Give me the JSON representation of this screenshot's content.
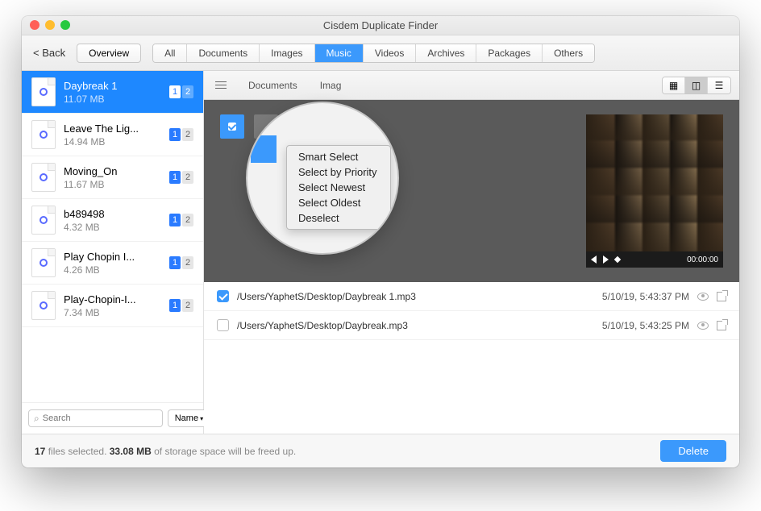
{
  "window": {
    "title": "Cisdem Duplicate Finder"
  },
  "toolbar": {
    "back": "< Back",
    "overview": "Overview",
    "tabs": [
      "All",
      "Documents",
      "Images",
      "Music",
      "Videos",
      "Archives",
      "Packages",
      "Others"
    ],
    "active_tab_index": 3
  },
  "sidebar": {
    "items": [
      {
        "name": "Daybreak 1",
        "size": "11.07 MB",
        "b1": "1",
        "b2": "2",
        "selected": true
      },
      {
        "name": "Leave The Lig...",
        "size": "14.94 MB",
        "b1": "1",
        "b2": "2",
        "selected": false
      },
      {
        "name": "Moving_On",
        "size": "11.67 MB",
        "b1": "1",
        "b2": "2",
        "selected": false
      },
      {
        "name": "b489498",
        "size": "4.32 MB",
        "b1": "1",
        "b2": "2",
        "selected": false
      },
      {
        "name": "Play Chopin I...",
        "size": "4.26 MB",
        "b1": "1",
        "b2": "2",
        "selected": false
      },
      {
        "name": "Play-Chopin-I...",
        "size": "7.34 MB",
        "b1": "1",
        "b2": "2",
        "selected": false
      }
    ],
    "search_placeholder": "Search",
    "sort_label": "Name"
  },
  "main": {
    "tabs": [
      "Documents",
      "Imag"
    ],
    "player_time": "00:00:00",
    "rows": [
      {
        "checked": true,
        "path": "/Users/YaphetS/Desktop/Daybreak 1.mp3",
        "date": "5/10/19, 5:43:37 PM"
      },
      {
        "checked": false,
        "path": "/Users/YaphetS/Desktop/Daybreak.mp3",
        "date": "5/10/19, 5:43:25 PM"
      }
    ]
  },
  "context_menu": {
    "items": [
      "Smart Select",
      "Select by Priority",
      "Select Newest",
      "Select Oldest",
      "Deselect"
    ]
  },
  "footer": {
    "count": "17",
    "text1": " files selected. ",
    "size": "33.08 MB",
    "text2": " of storage space will be freed up.",
    "delete": "Delete"
  },
  "icons": {
    "search": "⌕",
    "sort_arrow": "▾",
    "grid": "▦",
    "cols": "◫",
    "list": "☰"
  }
}
